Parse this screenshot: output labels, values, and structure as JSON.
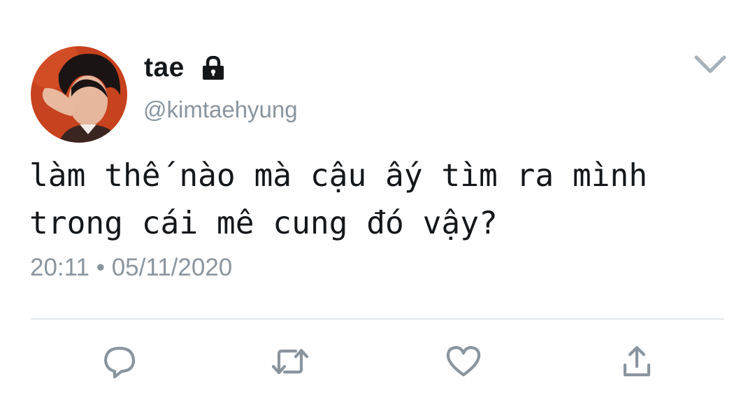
{
  "user": {
    "display_name": "tae",
    "handle": "@kimtaehyung",
    "protected_icon": "lock-icon",
    "avatar_icon": "profile-photo"
  },
  "tweet": {
    "text": "làm thế nào mà cậu ấy tìm ra mình\ntrong cái mê cung đó vậy?",
    "timestamp": "20:11 • 05/11/2020"
  },
  "menu": {
    "icon": "chevron-down-icon"
  },
  "actions": [
    {
      "name": "reply",
      "icon": "comment-icon"
    },
    {
      "name": "retweet",
      "icon": "retweet-icon"
    },
    {
      "name": "like",
      "icon": "heart-icon"
    },
    {
      "name": "share",
      "icon": "share-icon"
    }
  ],
  "colors": {
    "text_primary": "#14171a",
    "text_secondary": "#8a959e",
    "icon_gray": "#8a959e",
    "divider": "#e1e8ed",
    "avatar_background": "#c7421e"
  }
}
